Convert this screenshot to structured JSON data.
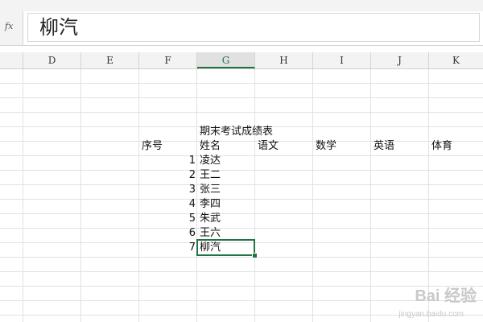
{
  "formula_bar": {
    "fx_label": "fx",
    "value": "柳汽"
  },
  "columns": [
    "D",
    "E",
    "F",
    "G",
    "H",
    "I",
    "J",
    "K"
  ],
  "selected_column": "G",
  "sheet": {
    "title": "期末考试成绩表",
    "headers": [
      "序号",
      "姓名",
      "语文",
      "数学",
      "英语",
      "体育"
    ],
    "rows": [
      {
        "no": "1",
        "name": "凌达"
      },
      {
        "no": "2",
        "name": "王二"
      },
      {
        "no": "3",
        "name": "张三"
      },
      {
        "no": "4",
        "name": "李四"
      },
      {
        "no": "5",
        "name": "朱武"
      },
      {
        "no": "6",
        "name": "王六"
      },
      {
        "no": "7",
        "name": "柳汽"
      }
    ]
  },
  "watermark": {
    "text": "Bai 经验",
    "sub": "jingyan.baidu.com"
  },
  "colors": {
    "accent": "#217346",
    "grid": "#e1e1e1",
    "header_bg": "#f3f3f3"
  }
}
